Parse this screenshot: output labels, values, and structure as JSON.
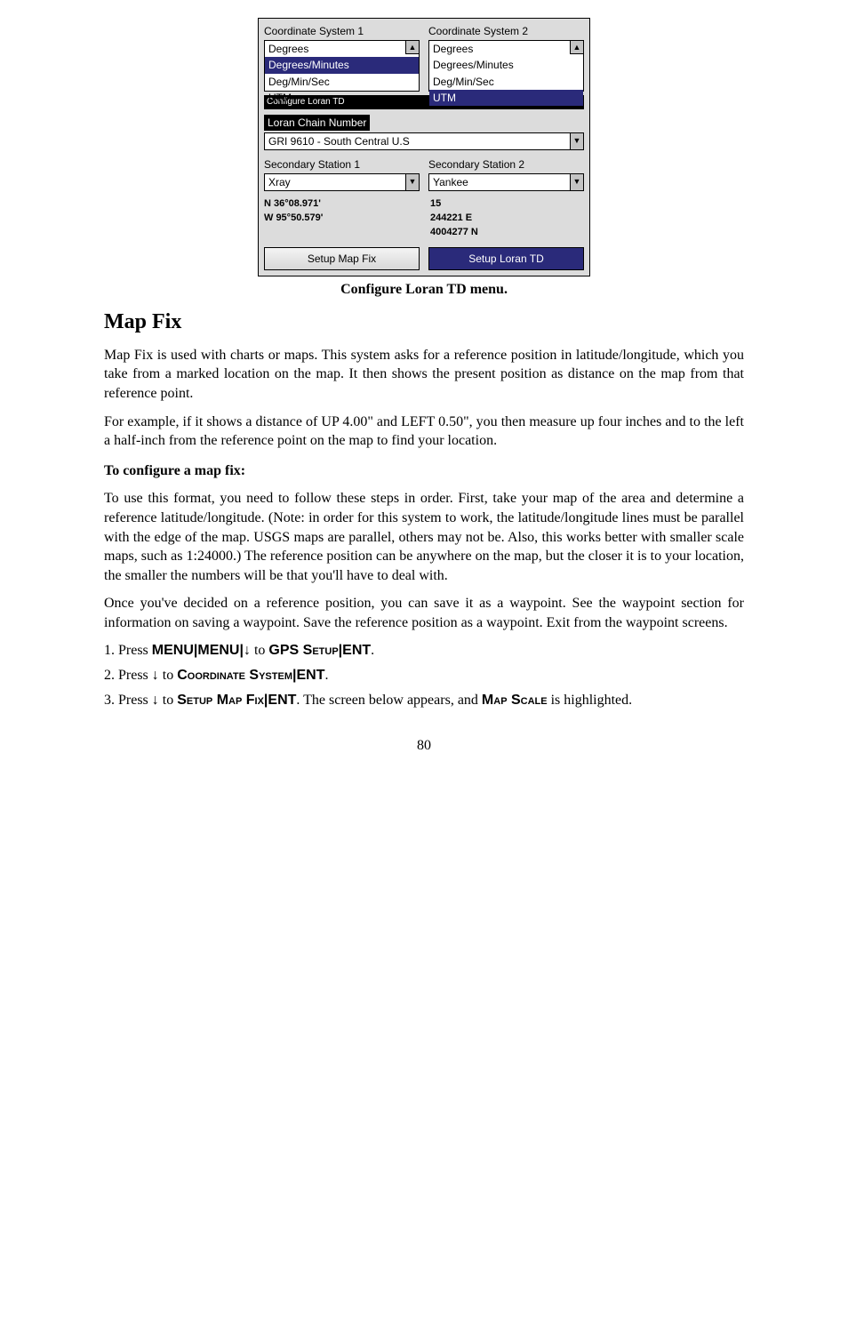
{
  "screenshot": {
    "cs1_label": "Coordinate System 1",
    "cs2_label": "Coordinate System 2",
    "list1": {
      "i0": "Degrees",
      "i1": "Degrees/Minutes",
      "i2": "Deg/Min/Sec",
      "i3": "UTM"
    },
    "list2": {
      "i0": "Degrees",
      "i1": "Degrees/Minutes",
      "i2": "Deg/Min/Sec",
      "i3": "UTM"
    },
    "config_bar": "Configure Loran TD",
    "loran_label": "Loran Chain Number",
    "loran_value": "GRI 9610 - South Central U.S",
    "sec1_label": "Secondary Station 1",
    "sec2_label": "Secondary Station 2",
    "sec1_value": "Xray",
    "sec2_value": "Yankee",
    "coord_left_1": "N   36°08.971'",
    "coord_left_2": "W   95°50.579'",
    "coord_right_1": "15",
    "coord_right_2": "244221  E",
    "coord_right_3": "4004277  N",
    "btn1": "Setup Map Fix",
    "btn2": "Setup Loran TD"
  },
  "caption": "Configure Loran TD menu.",
  "heading": "Map Fix",
  "para1": "Map Fix is used with charts or maps. This system asks for a reference position in latitude/longitude, which you take from a marked location on the map. It then shows the present position as distance on the map from that reference point.",
  "para2": "For example, if it shows a distance of UP 4.00\" and LEFT 0.50\", you then measure up four inches and to the left a half-inch from the reference point on the map to find your location.",
  "subhead": "To configure a map fix:",
  "para3": "To use this format, you need to follow these steps in order. First, take your map of the area and determine a reference latitude/longitude. (Note: in order for this system to work, the latitude/longitude lines must be parallel with the edge of the map. USGS maps are parallel, others may not be. Also, this works better with smaller scale maps, such as 1:24000.) The reference position can be anywhere on the map, but the closer it is to your location, the smaller the numbers will be that you'll have to deal with.",
  "para4": "Once you've decided on a reference position, you can save it as a waypoint. See the waypoint section for information on saving a waypoint. Save the reference position as a waypoint. Exit from the waypoint screens.",
  "steps": {
    "s1_pre": "1. Press ",
    "s1_menu1": "MENU",
    "s1_sep": "|",
    "s1_menu2": "MENU",
    "s1_arrow": "↓",
    "s1_to": " to ",
    "s1_gps": "GPS Setup",
    "s1_ent": "ENT",
    "s1_end": ".",
    "s2_pre": "2. Press ",
    "s2_arrow": "↓",
    "s2_to": " to ",
    "s2_coord": "Coordinate System",
    "s2_ent": "ENT",
    "s2_end": ".",
    "s3_pre": "3. Press ",
    "s3_arrow": "↓",
    "s3_to": " to ",
    "s3_setup": "Setup Map Fix",
    "s3_ent": "ENT",
    "s3_mid": ". The screen below appears, and ",
    "s3_map": "Map Scale",
    "s3_end": " is highlighted."
  },
  "pagenum": "80"
}
